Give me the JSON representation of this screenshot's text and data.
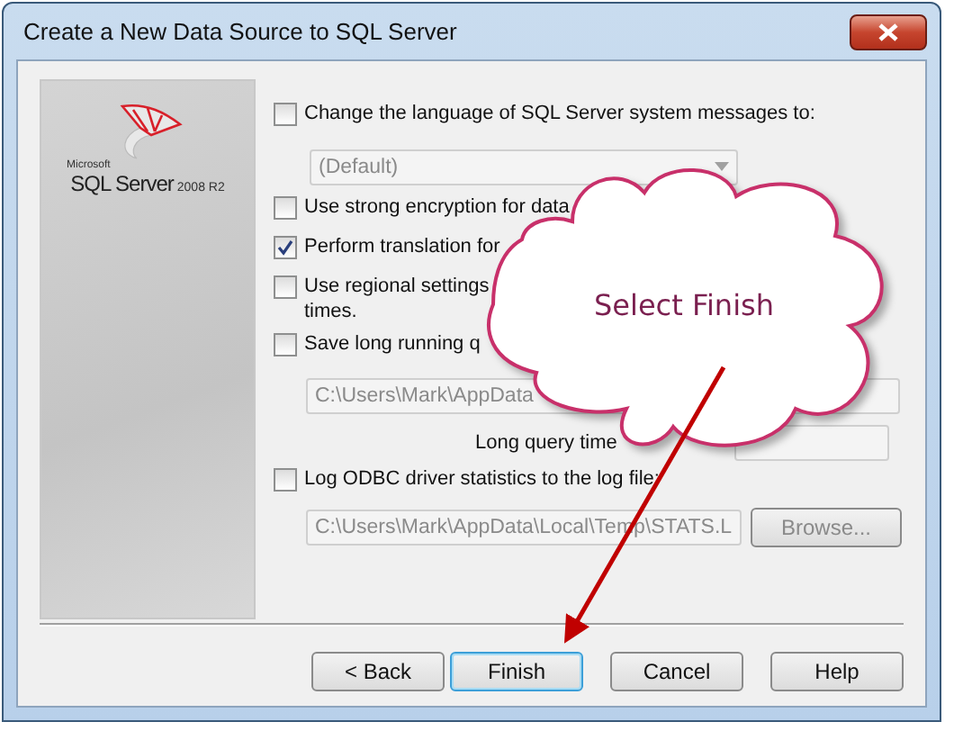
{
  "window": {
    "title": "Create a New Data Source to SQL Server"
  },
  "logo": {
    "maker": "Microsoft",
    "product": "SQL Server",
    "version": "2008 R2"
  },
  "options": [
    {
      "kind": "checkbox",
      "label": "Change the language of SQL Server system messages to:",
      "checked": false
    },
    {
      "kind": "dropdown",
      "value": "(Default)",
      "disabled": true
    },
    {
      "kind": "checkbox",
      "label": "Use strong encryption for data",
      "checked": false
    },
    {
      "kind": "checkbox",
      "label": "Perform translation for",
      "checked": true
    },
    {
      "kind": "checkbox",
      "label": "Use regional settings",
      "continuation": "times.",
      "checked": false
    },
    {
      "kind": "checkbox",
      "label": "Save long running q",
      "checked": false
    },
    {
      "kind": "path",
      "value": "C:\\Users\\Mark\\AppData",
      "disabled": true
    },
    {
      "kind": "labeled_field",
      "label": "Long query time",
      "disabled": true
    },
    {
      "kind": "checkbox",
      "label": "Log ODBC driver statistics to the log file:",
      "checked": false
    },
    {
      "kind": "path_browse",
      "value": "C:\\Users\\Mark\\AppData\\Local\\Temp\\STATS.L",
      "button": "Browse...",
      "disabled": true
    }
  ],
  "buttons": [
    {
      "label": "< Back",
      "focused": false
    },
    {
      "label": "Finish",
      "focused": true
    },
    {
      "label": "Cancel",
      "focused": false
    },
    {
      "label": "Help",
      "focused": false
    }
  ],
  "callout": {
    "text": "Select Finish"
  }
}
